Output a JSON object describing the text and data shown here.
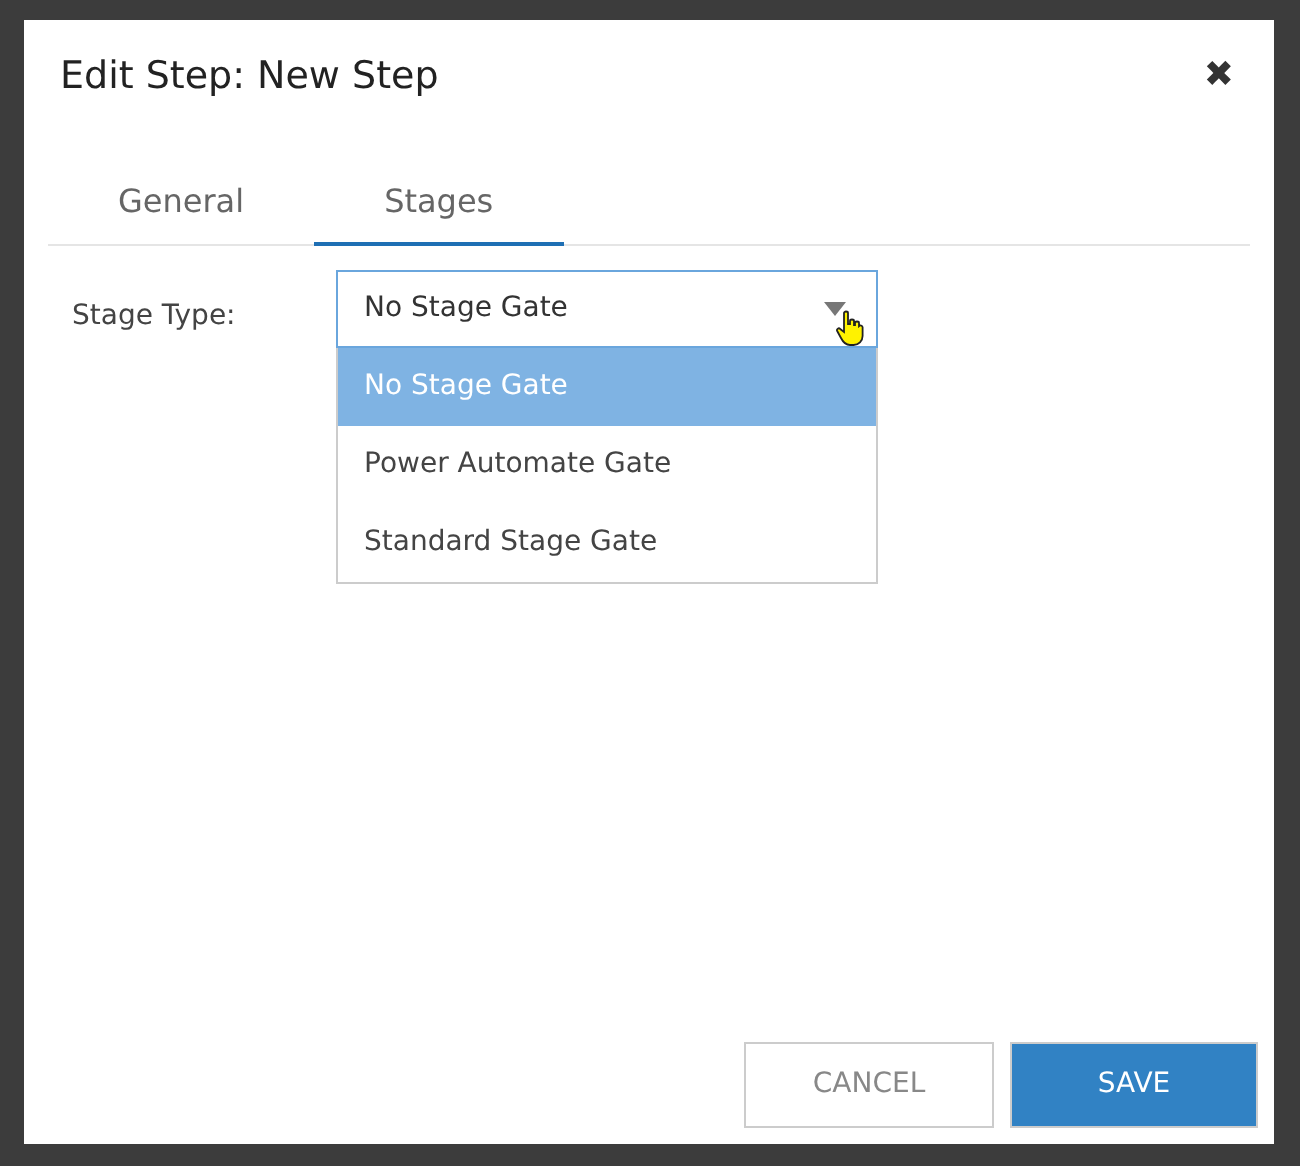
{
  "dialog": {
    "title": "Edit Step: New Step",
    "close": "✖"
  },
  "tabs": [
    {
      "label": "General",
      "selected": false
    },
    {
      "label": "Stages",
      "selected": true
    }
  ],
  "stage_type": {
    "label": "Stage Type:",
    "value": "No Stage Gate",
    "expanded": true,
    "options": [
      {
        "label": "No Stage Gate",
        "selected": true
      },
      {
        "label": "Power Automate Gate",
        "selected": false
      },
      {
        "label": "Standard Stage Gate",
        "selected": false
      }
    ]
  },
  "buttons": [
    {
      "label": "CANCEL",
      "kind": "secondary"
    },
    {
      "label": "SAVE",
      "kind": "primary"
    }
  ]
}
